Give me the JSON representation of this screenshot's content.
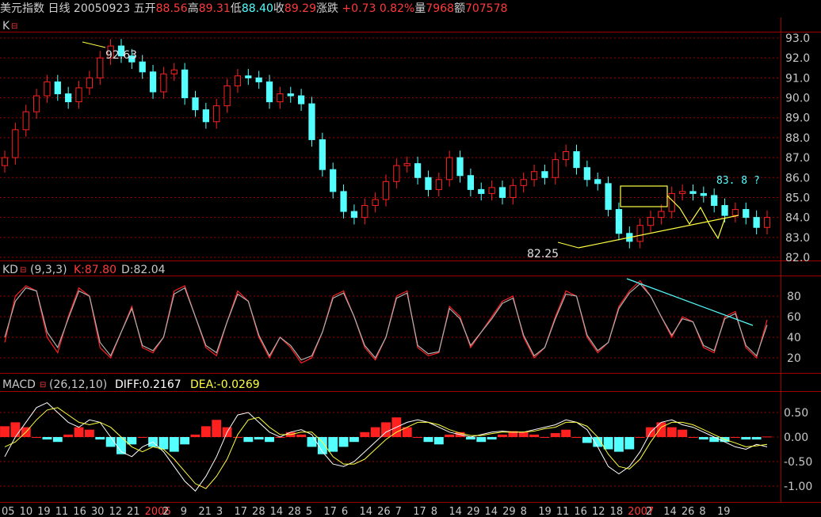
{
  "header": {
    "instrument": "美元指数",
    "period": "日线",
    "date": "20050923",
    "weekday": "五",
    "open_label": "开",
    "open": "88.56",
    "high_label": "高",
    "high": "89.31",
    "low_label": "低",
    "low": "88.40",
    "close_label": "收",
    "close": "89.29",
    "change_label": "涨跌",
    "change": "+0.73",
    "change_pct": "0.82%",
    "volume_label": "量",
    "volume": "7968",
    "amount_label": "额",
    "amount": "707578"
  },
  "price_panel": {
    "label": "K",
    "y_ticks": [
      "93.0",
      "92.0",
      "91.0",
      "90.0",
      "89.0",
      "88.0",
      "87.0",
      "86.0",
      "85.0",
      "84.0",
      "83.0",
      "82.0"
    ],
    "annotations": {
      "high": "92.63",
      "low": "82.25",
      "target": "83. 8 ?"
    }
  },
  "kd_panel": {
    "label": "KD",
    "params": "(9,3,3)",
    "k_text": "K:87.80",
    "d_text": "D:82.04",
    "y_ticks": [
      "80",
      "60",
      "40",
      "20"
    ]
  },
  "macd_panel": {
    "label": "MACD",
    "params": "(26,12,10)",
    "diff_text": "DIFF:0.2167",
    "dea_text": "DEA:-0.0269",
    "y_ticks": [
      "0.50",
      "0.00",
      "-0.50",
      "-1.00"
    ]
  },
  "x_axis": {
    "dates": [
      "05",
      "10",
      "19",
      "11",
      "16",
      "30",
      "12",
      "21",
      "2006",
      "2",
      "9",
      "21",
      "3",
      "17",
      "28",
      "14",
      "28",
      "5",
      "17",
      "6",
      "14",
      "26",
      "7",
      "17",
      "8",
      "14",
      "29",
      "14",
      "29",
      "8",
      "19",
      "11",
      "16",
      "12",
      "18",
      "2007",
      "2",
      "14",
      "26",
      "8",
      "19"
    ]
  },
  "colors": {
    "up": "#ff2020",
    "down": "#54ffff",
    "k_line": "#ff2020",
    "d_line": "#b0b0b0",
    "grid": "#a00000",
    "trend": "#ffff40"
  },
  "chart_data": [
    {
      "type": "candlestick",
      "title": "美元指数 日线",
      "ylim": [
        82.0,
        93.0
      ],
      "series": [
        {
          "name": "K",
          "values": [
            87.0,
            88.4,
            89.3,
            90.1,
            90.8,
            90.2,
            89.8,
            90.5,
            91.0,
            92.0,
            92.6,
            92.1,
            91.8,
            91.3,
            90.3,
            91.2,
            91.4,
            90.0,
            89.4,
            88.8,
            89.6,
            90.6,
            91.1,
            91.0,
            90.8,
            89.8,
            90.2,
            90.1,
            89.7,
            87.9,
            86.4,
            85.3,
            84.3,
            84.0,
            84.6,
            84.9,
            85.8,
            86.6,
            86.7,
            86.0,
            85.4,
            85.9,
            87.0,
            86.1,
            85.4,
            85.2,
            85.5,
            85.0,
            85.6,
            85.9,
            86.3,
            86.0,
            86.9,
            87.3,
            86.5,
            85.9,
            85.7,
            84.4,
            83.2,
            82.8,
            83.6,
            84.0,
            84.3,
            85.2,
            85.3,
            85.2,
            85.1,
            84.6,
            84.1,
            84.4,
            84.0,
            83.5,
            84.0
          ]
        }
      ],
      "annotations": [
        "92.63",
        "82.25",
        "83. 8 ?"
      ]
    },
    {
      "type": "line",
      "title": "KD (9,3,3)",
      "ylim": [
        10,
        100
      ],
      "series": [
        {
          "name": "K",
          "values": [
            35,
            80,
            90,
            85,
            40,
            25,
            60,
            88,
            80,
            30,
            20,
            45,
            70,
            30,
            25,
            40,
            85,
            90,
            60,
            30,
            22,
            55,
            85,
            75,
            40,
            20,
            40,
            30,
            15,
            20,
            45,
            80,
            85,
            60,
            30,
            18,
            40,
            80,
            85,
            30,
            22,
            25,
            70,
            60,
            30,
            45,
            60,
            75,
            80,
            40,
            20,
            30,
            60,
            85,
            80,
            40,
            25,
            35,
            70,
            85,
            95,
            80,
            60,
            40,
            60,
            55,
            30,
            25,
            60,
            65,
            30,
            20,
            57
          ]
        },
        {
          "name": "D",
          "values": [
            40,
            75,
            88,
            85,
            45,
            30,
            58,
            85,
            80,
            35,
            22,
            45,
            68,
            32,
            27,
            40,
            82,
            88,
            60,
            32,
            25,
            55,
            82,
            75,
            42,
            22,
            40,
            32,
            18,
            22,
            45,
            78,
            83,
            60,
            32,
            20,
            40,
            78,
            83,
            32,
            24,
            26,
            68,
            58,
            32,
            45,
            58,
            73,
            78,
            42,
            22,
            30,
            58,
            82,
            80,
            42,
            27,
            35,
            68,
            83,
            92,
            80,
            60,
            42,
            58,
            55,
            32,
            27,
            58,
            63,
            32,
            22,
            52
          ]
        }
      ]
    },
    {
      "type": "bar",
      "title": "MACD (26,12,10)",
      "ylim": [
        -1.2,
        0.9
      ],
      "series": [
        {
          "name": "MACD",
          "values": [
            0.22,
            0.3,
            0.2,
            0.0,
            -0.05,
            -0.1,
            0.05,
            0.2,
            0.15,
            -0.05,
            -0.2,
            -0.35,
            -0.15,
            0.0,
            -0.2,
            -0.25,
            -0.3,
            -0.15,
            0.05,
            0.22,
            0.35,
            0.2,
            0.0,
            -0.1,
            -0.05,
            -0.1,
            0.0,
            0.1,
            0.05,
            -0.2,
            -0.35,
            -0.3,
            -0.2,
            -0.1,
            0.1,
            0.2,
            0.3,
            0.4,
            0.2,
            0.0,
            -0.1,
            -0.15,
            0.05,
            0.1,
            -0.05,
            -0.1,
            -0.05,
            0.05,
            0.12,
            0.1,
            0.05,
            0.0,
            0.08,
            0.15,
            0.0,
            -0.12,
            -0.2,
            -0.25,
            -0.3,
            -0.25,
            0.0,
            0.2,
            0.3,
            0.2,
            0.15,
            0.0,
            -0.05,
            -0.1,
            -0.1,
            0.0,
            -0.05,
            -0.05,
            0.01
          ]
        },
        {
          "name": "DIFF",
          "values": [
            -0.4,
            0.0,
            0.3,
            0.6,
            0.7,
            0.5,
            0.3,
            0.2,
            0.35,
            0.3,
            0.0,
            -0.3,
            -0.4,
            -0.2,
            -0.1,
            -0.3,
            -0.6,
            -0.9,
            -1.1,
            -0.8,
            -0.4,
            0.1,
            0.45,
            0.5,
            0.3,
            0.1,
            0.0,
            0.1,
            0.15,
            0.05,
            -0.3,
            -0.55,
            -0.6,
            -0.5,
            -0.3,
            -0.1,
            0.1,
            0.2,
            0.3,
            0.35,
            0.3,
            0.2,
            0.1,
            0.05,
            0.0,
            0.05,
            0.1,
            0.12,
            0.1,
            0.1,
            0.15,
            0.2,
            0.25,
            0.35,
            0.3,
            0.15,
            -0.2,
            -0.6,
            -0.75,
            -0.6,
            -0.3,
            0.1,
            0.3,
            0.35,
            0.25,
            0.2,
            0.1,
            0.0,
            -0.1,
            -0.2,
            -0.25,
            -0.15,
            -0.2
          ]
        },
        {
          "name": "DEA",
          "values": [
            -0.2,
            -0.1,
            0.1,
            0.35,
            0.55,
            0.6,
            0.45,
            0.3,
            0.25,
            0.3,
            0.2,
            0.0,
            -0.2,
            -0.3,
            -0.2,
            -0.25,
            -0.45,
            -0.7,
            -0.95,
            -1.05,
            -0.8,
            -0.45,
            0.05,
            0.35,
            0.4,
            0.2,
            0.05,
            0.05,
            0.1,
            0.1,
            -0.1,
            -0.4,
            -0.55,
            -0.55,
            -0.45,
            -0.25,
            -0.05,
            0.1,
            0.2,
            0.3,
            0.3,
            0.25,
            0.15,
            0.08,
            0.03,
            0.03,
            0.07,
            0.1,
            0.1,
            0.1,
            0.12,
            0.17,
            0.2,
            0.3,
            0.3,
            0.22,
            0.0,
            -0.35,
            -0.6,
            -0.65,
            -0.45,
            -0.1,
            0.2,
            0.3,
            0.3,
            0.25,
            0.15,
            0.05,
            -0.05,
            -0.12,
            -0.2,
            -0.18,
            -0.15
          ]
        }
      ]
    }
  ]
}
